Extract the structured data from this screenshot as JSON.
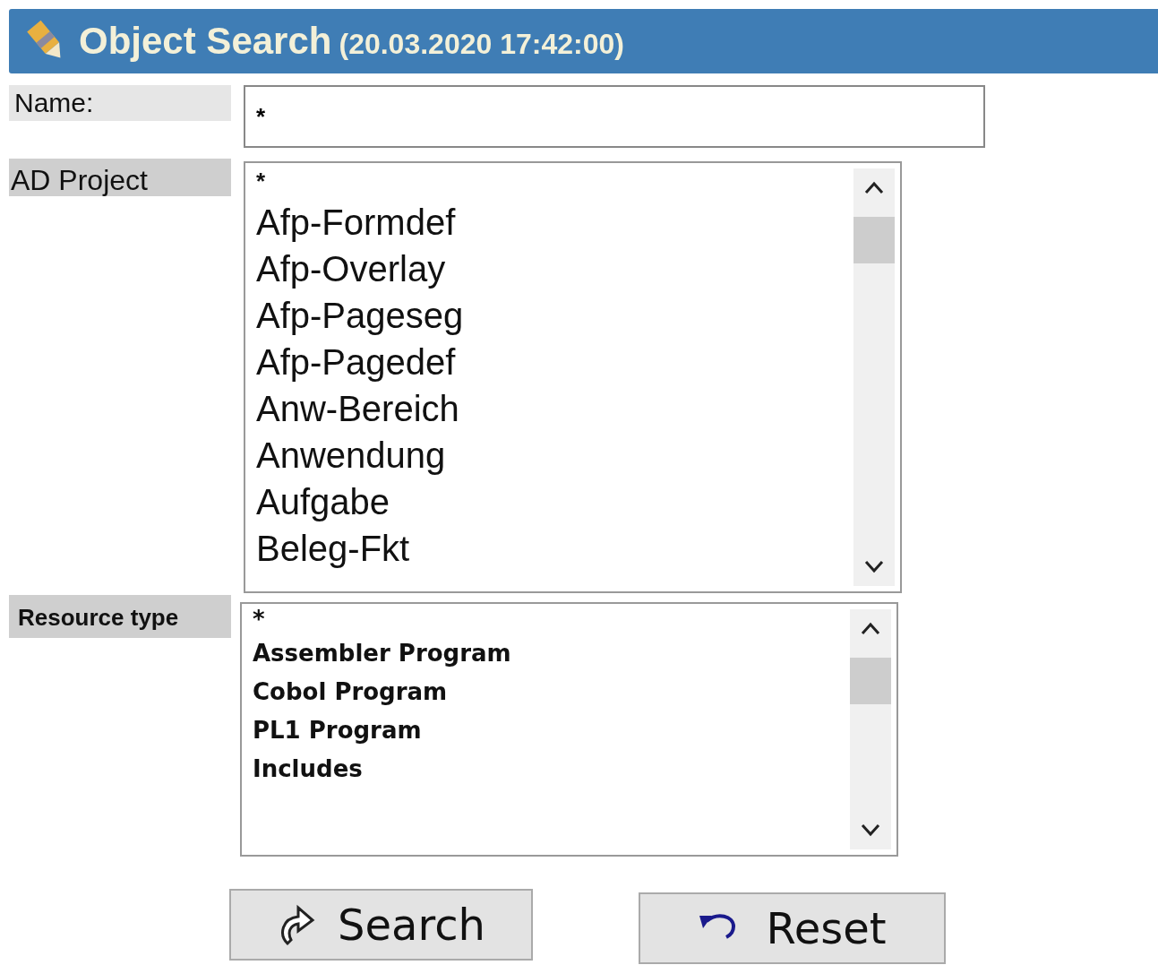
{
  "window": {
    "title": "Object Search",
    "timestamp": "(20.03.2020 17:42:00)"
  },
  "name_field": {
    "label": "Name:",
    "value": "*"
  },
  "ad_project": {
    "label": "AD Project",
    "items": [
      "*",
      "Afp-Formdef",
      "Afp-Overlay",
      "Afp-Pageseg",
      "Afp-Pagedef",
      "Anw-Bereich",
      "Anwendung",
      "Aufgabe",
      "Beleg-Fkt"
    ]
  },
  "resource_type": {
    "label": "Resource type",
    "items": [
      "*",
      "Assembler Program",
      "Cobol Program",
      "PL1 Program",
      "Includes"
    ]
  },
  "buttons": [
    {
      "kind": "search",
      "label": "Search"
    },
    {
      "kind": "reset",
      "label": "Reset"
    }
  ]
}
